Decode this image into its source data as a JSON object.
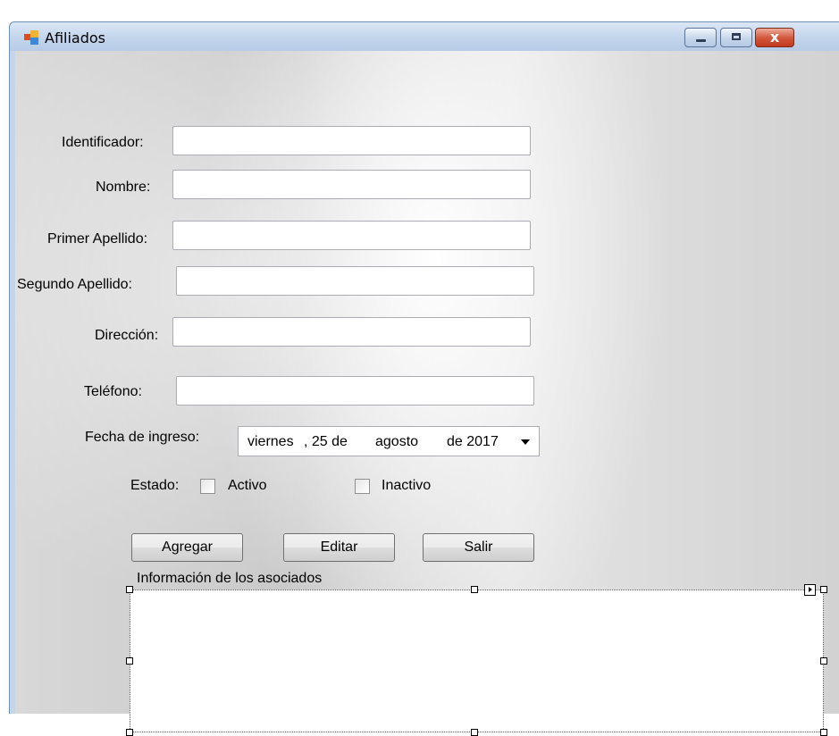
{
  "window": {
    "title": "Afiliados",
    "controls": {
      "minimize": "minimize-icon",
      "maximize": "maximize-icon",
      "close": "close-icon",
      "close_glyph": "x"
    }
  },
  "form": {
    "fields": [
      {
        "label": "Identificador:",
        "value": ""
      },
      {
        "label": "Nombre:",
        "value": ""
      },
      {
        "label": "Primer Apellido:",
        "value": ""
      },
      {
        "label": "Segundo Apellido:",
        "value": ""
      },
      {
        "label": "Dirección:",
        "value": ""
      },
      {
        "label": "Teléfono:",
        "value": ""
      }
    ],
    "fecha": {
      "label": "Fecha de ingreso:",
      "weekday": "viernes",
      "day": ", 25 de",
      "month": "agosto",
      "year": "de 2017"
    },
    "estado": {
      "label": "Estado:",
      "options": [
        {
          "label": "Activo",
          "checked": false
        },
        {
          "label": "Inactivo",
          "checked": false
        }
      ]
    },
    "buttons": {
      "agregar": "Agregar",
      "editar": "Editar",
      "salir": "Salir"
    },
    "grid": {
      "caption": "Información de los asociados",
      "rows": []
    }
  },
  "colors": {
    "close_button": "#c2371d",
    "title_bar": "#c3d5ec",
    "client": "#d2d2d2"
  }
}
